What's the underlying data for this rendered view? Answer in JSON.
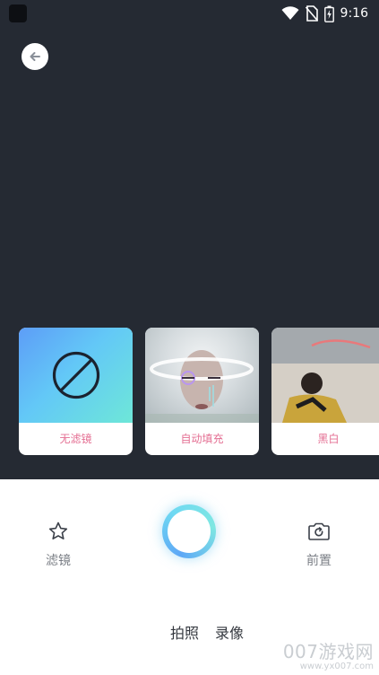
{
  "status_bar": {
    "time": "9:16"
  },
  "filters": [
    {
      "label": "无滤镜",
      "selected": false
    },
    {
      "label": "自动填充",
      "selected": false
    },
    {
      "label": "黑白",
      "selected": false
    }
  ],
  "controls": {
    "filter_label": "滤镜",
    "switch_camera_label": "前置"
  },
  "modes": [
    {
      "label": "拍照"
    },
    {
      "label": "录像"
    }
  ],
  "watermark": {
    "main": "007游戏网",
    "sub": "www.yx007.com"
  },
  "colors": {
    "camera_background": "#252a33",
    "filter_label": "#e46f93",
    "shutter_gradient_start": "#5ea8f6",
    "shutter_gradient_end": "#7fe7e2"
  }
}
